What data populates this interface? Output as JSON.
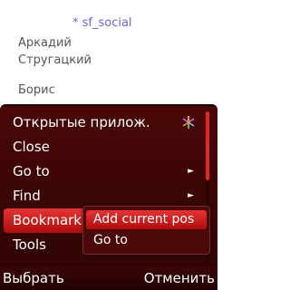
{
  "background": {
    "tag": "* sf_social",
    "names": [
      [
        "Аркадий",
        "Стругацкий"
      ],
      [
        "Борис"
      ]
    ]
  },
  "menu": {
    "items": [
      {
        "label": "Открытые прилож.",
        "icon": "active-tasks-icon",
        "submenu": false
      },
      {
        "label": "Close",
        "submenu": false
      },
      {
        "label": "Go to",
        "submenu": true
      },
      {
        "label": "Find",
        "submenu": true
      },
      {
        "label": "Bookmarks",
        "submenu": true,
        "highlighted": true
      },
      {
        "label": "Tools",
        "submenu": false
      }
    ],
    "submenu_arrow": "►",
    "submenu": {
      "items": [
        {
          "label": "Add current pos",
          "highlighted": true
        },
        {
          "label": "Go to"
        }
      ]
    }
  },
  "softkeys": {
    "left": "Выбрать",
    "right": "Отменить"
  },
  "colors": {
    "menu_bg": "#3a0606",
    "highlight": "#d42222",
    "text": "#ffffff",
    "tag_text": "#6666dd"
  }
}
